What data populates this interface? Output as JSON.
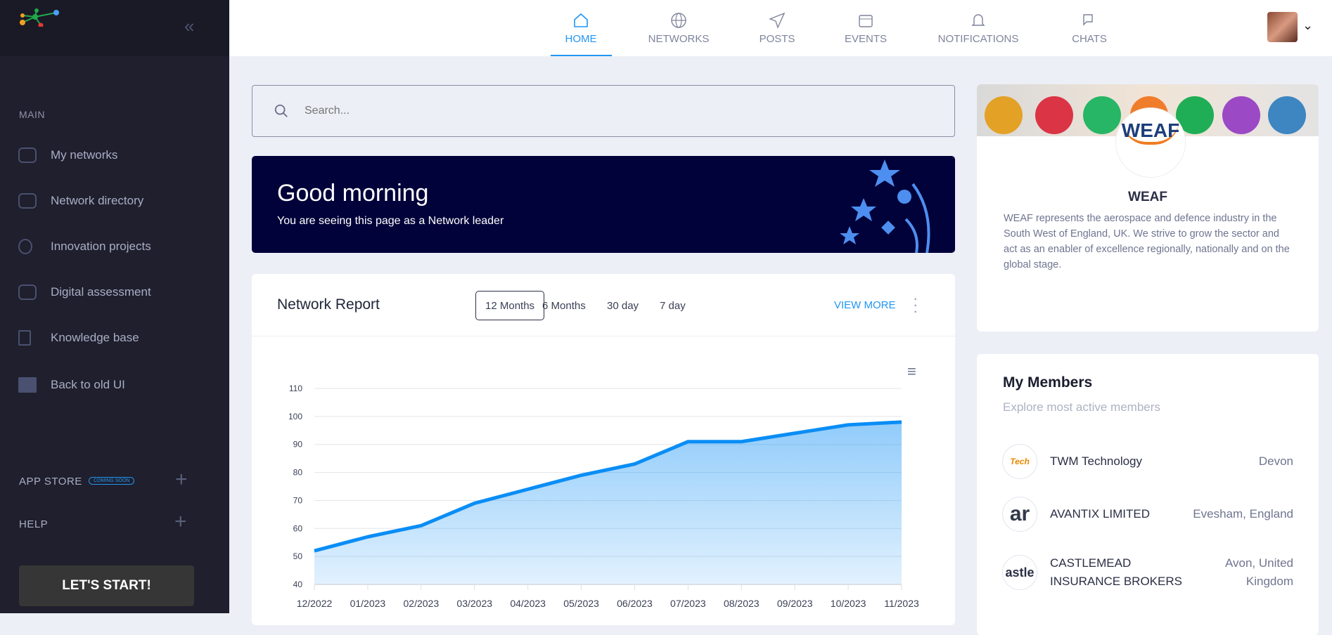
{
  "sidebar": {
    "section": "MAIN",
    "items": [
      {
        "label": "My networks",
        "icon": "users-icon"
      },
      {
        "label": "Network directory",
        "icon": "directory-icon"
      },
      {
        "label": "Innovation projects",
        "icon": "lightbulb-icon"
      },
      {
        "label": "Digital assessment",
        "icon": "monitor-icon"
      },
      {
        "label": "Knowledge base",
        "icon": "book-icon"
      },
      {
        "label": "Back to old UI",
        "icon": "layout-icon"
      }
    ],
    "app_store": "APP STORE",
    "coming_soon": "COMING SOON",
    "help": "HELP",
    "cta": "LET'S START!"
  },
  "nav": [
    {
      "label": "HOME",
      "icon": "home-icon",
      "active": true
    },
    {
      "label": "NETWORKS",
      "icon": "globe-icon"
    },
    {
      "label": "POSTS",
      "icon": "send-icon"
    },
    {
      "label": "EVENTS",
      "icon": "calendar-icon"
    },
    {
      "label": "NOTIFICATIONS",
      "icon": "bell-icon"
    },
    {
      "label": "CHATS",
      "icon": "chat-icon"
    }
  ],
  "search": {
    "placeholder": "Search..."
  },
  "banner": {
    "title": "Good morning",
    "subtitle": "You are seeing this page as a Network leader"
  },
  "report": {
    "title": "Network Report",
    "periods": [
      "12 Months",
      "6 Months",
      "30 day",
      "7 day"
    ],
    "active_period": "12 Months",
    "view_more": "VIEW MORE"
  },
  "chart_data": {
    "type": "area",
    "categories": [
      "12/2022",
      "01/2023",
      "02/2023",
      "03/2023",
      "04/2023",
      "05/2023",
      "06/2023",
      "07/2023",
      "08/2023",
      "09/2023",
      "10/2023",
      "11/2023"
    ],
    "values": [
      52,
      57,
      61,
      69,
      74,
      79,
      83,
      91,
      91,
      94,
      97,
      98
    ],
    "yticks": [
      40,
      50,
      60,
      70,
      80,
      90,
      100,
      110
    ],
    "ylim": [
      40,
      110
    ],
    "grid": true,
    "color": "#0a8df5"
  },
  "org": {
    "name": "WEAF",
    "logo_text": "WEAF",
    "description": "WEAF represents the aerospace and defence industry in the South West of England, UK. We strive to grow the sector and act as an enabler of excellence regionally, nationally and on the global stage."
  },
  "members": {
    "title": "My Members",
    "subtitle": "Explore most active members",
    "items": [
      {
        "name": "TWM Technology",
        "location": "Devon",
        "logo": "Tech"
      },
      {
        "name": "AVANTIX LIMITED",
        "location": "Evesham, England",
        "logo": "ar"
      },
      {
        "name": "CASTLEMEAD INSURANCE BROKERS",
        "location": "Avon, United Kingdom",
        "logo": "astle"
      }
    ]
  }
}
